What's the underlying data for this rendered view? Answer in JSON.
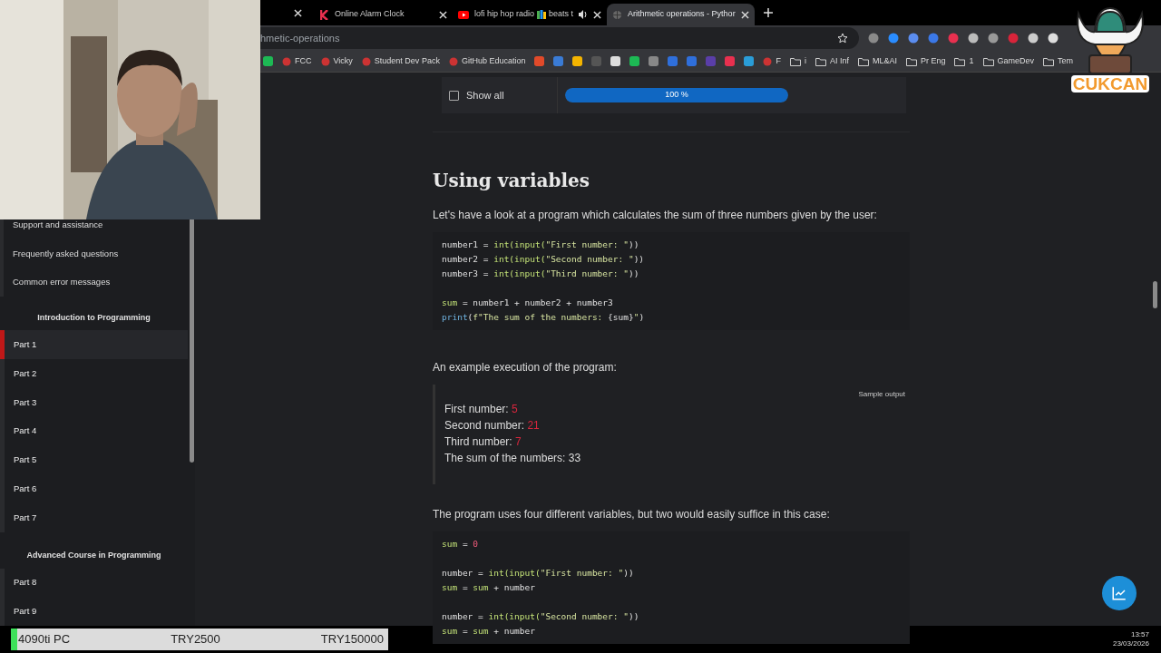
{
  "tabs": [
    {
      "title": "Online Alarm Clock",
      "selected": false
    },
    {
      "title": "lofi hip hop radio",
      "title_end": "beats t",
      "selected": false,
      "audio": true
    },
    {
      "title": "Arithmetic operations - Pythor",
      "selected": true
    }
  ],
  "address": {
    "value": "hmetic-operations"
  },
  "bookmarks": [
    {
      "kind": "link",
      "label": "FCC"
    },
    {
      "kind": "link",
      "label": "Vicky"
    },
    {
      "kind": "link",
      "label": "Student Dev Pack"
    },
    {
      "kind": "link",
      "label": "GitHub Education"
    },
    {
      "kind": "link",
      "label": "F"
    },
    {
      "kind": "folder",
      "label": "i"
    },
    {
      "kind": "folder",
      "label": "AI Inf"
    },
    {
      "kind": "folder",
      "label": "ML&AI"
    },
    {
      "kind": "folder",
      "label": "Pr Eng"
    },
    {
      "kind": "folder",
      "label": "1"
    },
    {
      "kind": "folder",
      "label": "GameDev"
    },
    {
      "kind": "folder",
      "label": "Tem"
    }
  ],
  "sidebar": {
    "items": [
      {
        "kind": "link",
        "label": "Support and assistance"
      },
      {
        "kind": "link",
        "label": "Frequently asked questions"
      },
      {
        "kind": "link",
        "label": "Common error messages"
      },
      {
        "kind": "heading",
        "label": "Introduction to Programming"
      },
      {
        "kind": "part",
        "label": "Part 1",
        "selected": true
      },
      {
        "kind": "part",
        "label": "Part 2",
        "selected": false
      },
      {
        "kind": "part",
        "label": "Part 3",
        "selected": false
      },
      {
        "kind": "part",
        "label": "Part 4",
        "selected": false
      },
      {
        "kind": "part",
        "label": "Part 5",
        "selected": false
      },
      {
        "kind": "part",
        "label": "Part 6",
        "selected": false
      },
      {
        "kind": "part",
        "label": "Part 7",
        "selected": false
      },
      {
        "kind": "heading",
        "label": "Advanced Course in Programming"
      },
      {
        "kind": "part",
        "label": "Part 8",
        "selected": false
      },
      {
        "kind": "part",
        "label": "Part 9",
        "selected": false
      }
    ]
  },
  "quiz_bar": {
    "show_all": {
      "label": "Show all",
      "checked": false
    },
    "progress": {
      "level": 1,
      "label": "100 %"
    }
  },
  "content": [
    {
      "kind": "heading",
      "text": "Using variables"
    },
    {
      "kind": "paragraph",
      "text": "Let's have a look at a program which calculates the sum of three numbers given by the user:"
    },
    {
      "kind": "code",
      "lines": [
        {
          "kind": "code",
          "tokens": [
            {
              "kind": "plain",
              "text": "number1 = "
            },
            {
              "kind": "builtin",
              "text": "int(input("
            },
            {
              "kind": "string",
              "text": "\"First number: \""
            },
            {
              "kind": "plain",
              "text": "))"
            }
          ]
        },
        {
          "kind": "code",
          "tokens": [
            {
              "kind": "plain",
              "text": "number2 = "
            },
            {
              "kind": "builtin",
              "text": "int(input("
            },
            {
              "kind": "string",
              "text": "\"Second number: \""
            },
            {
              "kind": "plain",
              "text": "))"
            }
          ]
        },
        {
          "kind": "code",
          "tokens": [
            {
              "kind": "plain",
              "text": "number3 = "
            },
            {
              "kind": "builtin",
              "text": "int(input("
            },
            {
              "kind": "string",
              "text": "\"Third number: \""
            },
            {
              "kind": "plain",
              "text": "))"
            }
          ]
        },
        {
          "kind": "blank"
        },
        {
          "kind": "code",
          "tokens": [
            {
              "kind": "builtin",
              "text": "sum"
            },
            {
              "kind": "plain",
              "text": " = number1 + number2 + number3"
            }
          ]
        },
        {
          "kind": "code",
          "tokens": [
            {
              "kind": "function",
              "text": "print"
            },
            {
              "kind": "plain",
              "text": "("
            },
            {
              "kind": "string",
              "text": "f\"The sum of the numbers: "
            },
            {
              "kind": "plain",
              "text": "{sum}"
            },
            {
              "kind": "string",
              "text": "\""
            },
            {
              "kind": "plain",
              "text": ")"
            }
          ]
        }
      ]
    },
    {
      "kind": "paragraph",
      "text": "An example execution of the program:"
    },
    {
      "kind": "output",
      "label": "Sample output",
      "lines": [
        {
          "text": "First number: ",
          "input": "5"
        },
        {
          "text": "Second number: ",
          "input": "21"
        },
        {
          "text": "Third number: ",
          "input": "7"
        },
        {
          "text": "The sum of the numbers: 33"
        }
      ]
    },
    {
      "kind": "paragraph",
      "text": "The program uses four different variables, but two would easily suffice in this case:"
    },
    {
      "kind": "code",
      "lines": [
        {
          "kind": "code",
          "tokens": [
            {
              "kind": "builtin",
              "text": "sum"
            },
            {
              "kind": "plain",
              "text": " = "
            },
            {
              "kind": "number",
              "text": "0"
            }
          ]
        },
        {
          "kind": "blank"
        },
        {
          "kind": "code",
          "tokens": [
            {
              "kind": "plain",
              "text": "number = "
            },
            {
              "kind": "builtin",
              "text": "int(input("
            },
            {
              "kind": "string",
              "text": "\"First number: \""
            },
            {
              "kind": "plain",
              "text": "))"
            }
          ]
        },
        {
          "kind": "code",
          "tokens": [
            {
              "kind": "builtin",
              "text": "sum"
            },
            {
              "kind": "plain",
              "text": " = "
            },
            {
              "kind": "builtin",
              "text": "sum"
            },
            {
              "kind": "plain",
              "text": " + number"
            }
          ]
        },
        {
          "kind": "blank"
        },
        {
          "kind": "code",
          "tokens": [
            {
              "kind": "plain",
              "text": "number = "
            },
            {
              "kind": "builtin",
              "text": "int(input("
            },
            {
              "kind": "string",
              "text": "\"Second number: \""
            },
            {
              "kind": "plain",
              "text": "))"
            }
          ]
        },
        {
          "kind": "code",
          "tokens": [
            {
              "kind": "builtin",
              "text": "sum"
            },
            {
              "kind": "plain",
              "text": " = "
            },
            {
              "kind": "builtin",
              "text": "sum"
            },
            {
              "kind": "plain",
              "text": " + number"
            }
          ]
        }
      ]
    }
  ],
  "goal": {
    "name": "4090ti PC",
    "current": "TRY2500",
    "target": "TRY150000",
    "level": 0.017
  },
  "clock": {
    "time": "13:57",
    "date": "23/03/2026"
  },
  "logo": {
    "text": "CUKCAN"
  }
}
